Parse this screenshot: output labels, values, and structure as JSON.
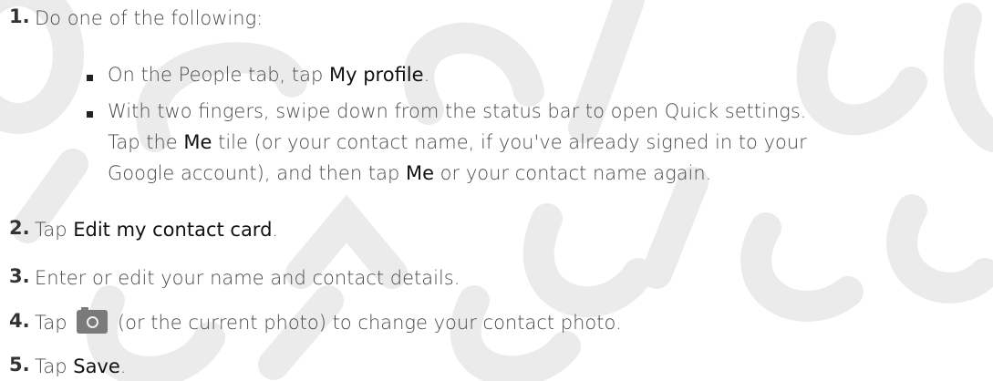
{
  "steps": [
    {
      "num": "1.",
      "text": "Do one of the following:"
    },
    {
      "num": "2.",
      "pre": "Tap ",
      "em": "Edit my contact card",
      "post": "."
    },
    {
      "num": "3.",
      "text": "Enter or edit your name and contact details."
    },
    {
      "num": "4.",
      "pre": "Tap ",
      "post": " (or the current photo) to change your contact photo."
    },
    {
      "num": "5.",
      "pre": "Tap ",
      "em": "Save",
      "post": "."
    }
  ],
  "sub_bullets": [
    {
      "pre": "On the People tab, tap ",
      "em": "My profile",
      "post": "."
    },
    {
      "line1": "With two fingers, swipe down from the status bar to open Quick settings.",
      "line2_pre": "Tap the ",
      "line2_em": "Me",
      "line2_post": " tile (or your contact name, if you've already signed in to your",
      "line3_pre": "Google account), and then tap ",
      "line3_em": "Me",
      "line3_post": " or your contact name again."
    }
  ],
  "camera_icon": "camera-icon",
  "watermark_color": "#e9e9e9",
  "watermark_words": [
    "Co",
    "Ce",
    "rtifice",
    "Certific",
    "TC",
    "r"
  ]
}
